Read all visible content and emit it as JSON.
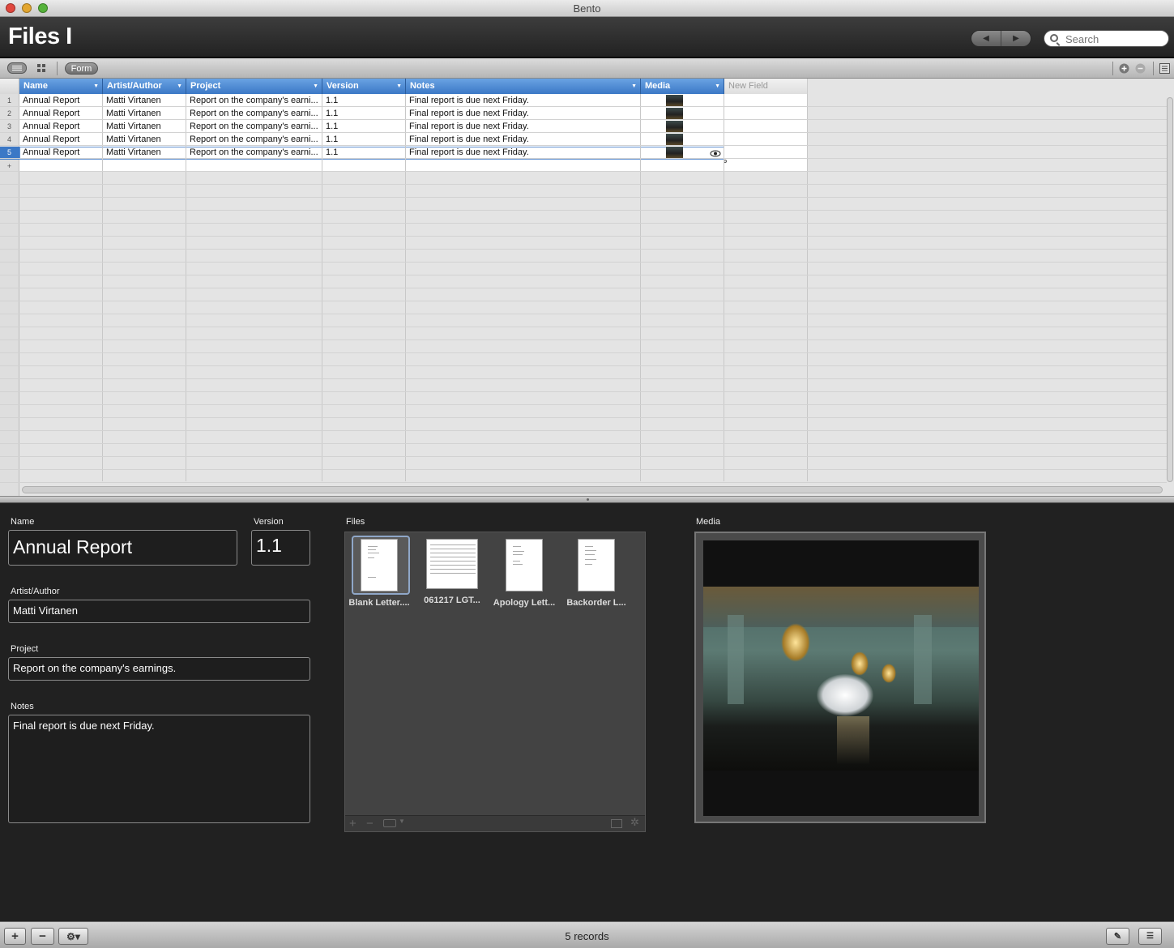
{
  "window": {
    "title": "Bento"
  },
  "header": {
    "library_title": "Files I",
    "search_placeholder": "Search"
  },
  "toolbar": {
    "form_label": "Form"
  },
  "table": {
    "columns": [
      "Name",
      "Artist/Author",
      "Project",
      "Version",
      "Notes",
      "Media"
    ],
    "new_field_label": "New Field",
    "row_numbers": [
      "1",
      "2",
      "3",
      "4",
      "5"
    ],
    "add_row_symbol": "+",
    "rows": [
      [
        "Annual Report",
        "Matti Virtanen",
        "Report on the company's earni...",
        "1.1",
        "Final report is due next Friday."
      ],
      [
        "Annual Report",
        "Matti Virtanen",
        "Report on the company's earni...",
        "1.1",
        "Final report is due next Friday."
      ],
      [
        "Annual Report",
        "Matti Virtanen",
        "Report on the company's earni...",
        "1.1",
        "Final report is due next Friday."
      ],
      [
        "Annual Report",
        "Matti Virtanen",
        "Report on the company's earni...",
        "1.1",
        "Final report is due next Friday."
      ],
      [
        "Annual Report",
        "Matti Virtanen",
        "Report on the company's earni...",
        "1.1",
        "Final report is due next Friday."
      ]
    ]
  },
  "form": {
    "name_label": "Name",
    "name_value": "Annual Report",
    "version_label": "Version",
    "version_value": "1.1",
    "author_label": "Artist/Author",
    "author_value": "Matti Virtanen",
    "project_label": "Project",
    "project_value": "Report on the company's earnings.",
    "notes_label": "Notes",
    "notes_value": "Final report is due next Friday.",
    "files_label": "Files",
    "media_label": "Media",
    "files": [
      "Blank Letter....",
      "061217 LGT...",
      "Apology Lett...",
      "Backorder L..."
    ]
  },
  "status": {
    "records": "5 records"
  },
  "colors": {
    "header_blue": "#3b78c6",
    "form_bg": "#212121"
  }
}
